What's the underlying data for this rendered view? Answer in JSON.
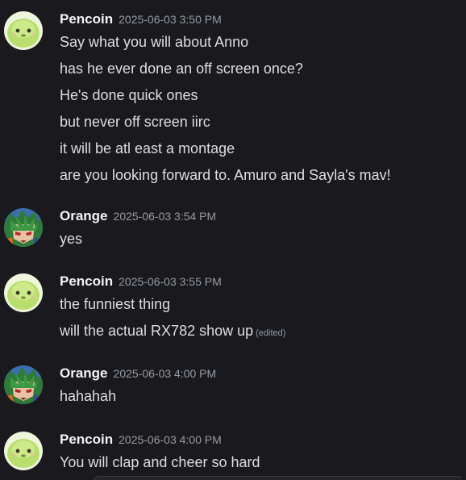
{
  "messages": [
    {
      "user": "Pencoin",
      "avatar": "green-blob-avatar",
      "timestamp": "2025-06-03 3:50 PM",
      "lines": [
        "Say what you will about Anno",
        "has he ever done an off screen once?",
        "He's done quick ones",
        "but never off screen iirc",
        "it will be atl east a montage",
        "are you looking forward to. Amuro and Sayla's mav!"
      ]
    },
    {
      "user": "Orange",
      "avatar": "anime-character-avatar",
      "timestamp": "2025-06-03 3:54 PM",
      "lines": [
        "yes"
      ]
    },
    {
      "user": "Pencoin",
      "avatar": "green-blob-avatar",
      "timestamp": "2025-06-03 3:55 PM",
      "lines": [
        "the funniest thing",
        "will the actual RX782 show up"
      ],
      "edited_label": "(edited)"
    },
    {
      "user": "Orange",
      "avatar": "anime-character-avatar",
      "timestamp": "2025-06-03 4:00 PM",
      "lines": [
        "hahahah"
      ]
    },
    {
      "user": "Pencoin",
      "avatar": "green-blob-avatar",
      "timestamp": "2025-06-03 4:00 PM",
      "lines": [
        "You will clap and cheer so hard"
      ]
    }
  ],
  "colors": {
    "background": "#1a1a1e",
    "username": "#f2f3f5",
    "timestamp": "#949ba4",
    "text": "#dbdee1"
  }
}
